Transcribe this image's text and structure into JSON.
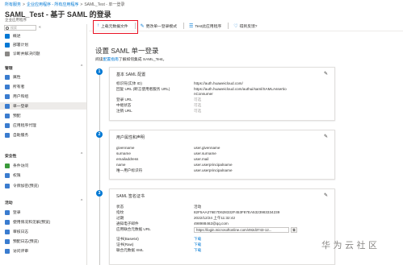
{
  "breadcrumb": {
    "items": [
      "所有服务",
      "企业应用程序 - 所有应用程序",
      "SAML_Test - 单一登录"
    ],
    "separator": ">"
  },
  "page": {
    "title": "SAML_Test - 基于 SAML 的登录",
    "subtitle": "企业应用程序"
  },
  "sidebar": {
    "search_placeholder": "搜索",
    "collapse_glyph": "«",
    "items_top": [
      {
        "label": "概述",
        "color": "#0078d4"
      },
      {
        "label": "部署计划",
        "color": "#0078d4"
      },
      {
        "label": "诊断并解决问题",
        "color": "#605e5c"
      }
    ],
    "section_manage": "管理",
    "items_manage": [
      {
        "label": "属性",
        "color": "#3a7ccf"
      },
      {
        "label": "所有者",
        "color": "#3a7ccf"
      },
      {
        "label": "用户和组",
        "color": "#3a7ccf"
      },
      {
        "label": "单一登录",
        "color": "#3a7ccf"
      },
      {
        "label": "预配",
        "color": "#3a7ccf"
      },
      {
        "label": "应用程序代理",
        "color": "#3a7ccf"
      },
      {
        "label": "自助服务",
        "color": "#3a7ccf"
      }
    ],
    "section_security": "安全性",
    "items_security": [
      {
        "label": "条件访问",
        "color": "#3a9a3a"
      },
      {
        "label": "权限",
        "color": "#3a7ccf"
      },
      {
        "label": "令牌加密(预览)",
        "color": "#3a7ccf"
      }
    ],
    "section_activity": "活动",
    "items_activity": [
      {
        "label": "登录",
        "color": "#3a7ccf"
      },
      {
        "label": "使用情况和见解(预览)",
        "color": "#3a7ccf"
      },
      {
        "label": "审核日志",
        "color": "#3a7ccf"
      },
      {
        "label": "预配日志(预览)",
        "color": "#3a7ccf"
      },
      {
        "label": "访问评审",
        "color": "#3a7ccf"
      }
    ]
  },
  "toolbar": {
    "upload": "上载元数据文件",
    "change_mode": "更改单一登录模式",
    "test": "Test此应用程序",
    "feedback": "得到反馈?"
  },
  "header": {
    "title": "设置 SAML 单一登录",
    "sub_prefix": "阅读",
    "sub_link": "配置指南",
    "sub_suffix": "了解如何集成 SAML_Test。"
  },
  "card1": {
    "step": "1",
    "title": "基本 SAML 配置",
    "rows": [
      {
        "label": "标识符(实体 ID)",
        "value": "https://auth.huaweicloud.com/",
        "kind": "normal"
      },
      {
        "label": "回复 URL (断言使用者服务 URL)",
        "value": "https://auth.huaweicloud.com/authui/saml/SAMLAssertio",
        "kind": "normal"
      },
      {
        "label": "",
        "value": "nConsumer",
        "kind": "normal"
      },
      {
        "label": "登录 URL",
        "value": "可选",
        "kind": "opt"
      },
      {
        "label": "中继状态",
        "value": "可选",
        "kind": "opt"
      },
      {
        "label": "注销 URL",
        "value": "可选",
        "kind": "opt"
      }
    ]
  },
  "card2": {
    "step": "2",
    "title": "用户属性和声明",
    "rows": [
      {
        "label": "givenname",
        "value": "user.givenname"
      },
      {
        "label": "surname",
        "value": "user.surname"
      },
      {
        "label": "emailaddress",
        "value": "user.mail"
      },
      {
        "label": "name",
        "value": "user.userprincipalname"
      },
      {
        "label": "唯一用户标识符",
        "value": "user.userprincipalname"
      }
    ]
  },
  "card3": {
    "step": "3",
    "title": "SAML 签名证书",
    "rows": [
      {
        "label": "状态",
        "value": "活动",
        "kind": "normal"
      },
      {
        "label": "指纹",
        "value": "82F5AA276E7D628332F453F87EA5323983334239",
        "kind": "normal"
      },
      {
        "label": "过期",
        "value": "2022/12/24 上午11:32:42",
        "kind": "normal"
      },
      {
        "label": "通知电子邮件",
        "value": "498988462@qq.com",
        "kind": "normal"
      }
    ],
    "metadata_label": "应用联合元数据 URL",
    "metadata_url": "https://login.microsoftonline.com/492d3743-12...",
    "copy_glyph": "⧉",
    "link_rows": [
      {
        "label": "证书(Base64)",
        "value": "下载"
      },
      {
        "label": "证书(Raw)",
        "value": "下载"
      },
      {
        "label": "联合元数据 XML",
        "value": "下载"
      }
    ]
  },
  "watermark": "华为云社区"
}
